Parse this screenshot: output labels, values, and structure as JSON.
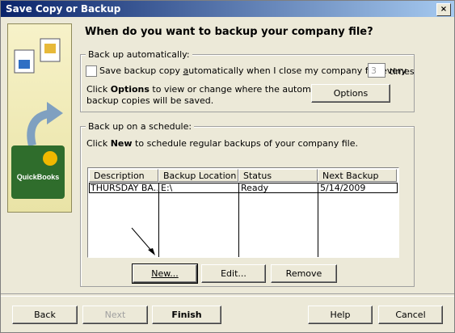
{
  "window": {
    "title": "Save Copy or Backup",
    "close_label": "×"
  },
  "heading": "When do you want to backup your company file?",
  "auto_backup": {
    "legend": "Back up automatically:",
    "checkbox_label_pre": "Save backup copy ",
    "checkbox_label_u": "a",
    "checkbox_label_post": "utomatically when I close my company file every",
    "times_value": "3",
    "times_label": "times",
    "info_pre": "Click ",
    "info_bold": "Options",
    "info_post_line1": " to view or change where the automatic",
    "info_line2": "backup copies will be saved.",
    "options_button": "Options"
  },
  "schedule": {
    "legend": "Back up on a schedule:",
    "info_pre": "Click ",
    "info_bold": "New",
    "info_post": " to schedule regular backups of your company file.",
    "columns": [
      "Description",
      "Backup Location",
      "Status",
      "Next Backup"
    ],
    "rows": [
      {
        "description": "THURSDAY BA...",
        "location": "E:\\",
        "status": "Ready",
        "next": "5/14/2009"
      }
    ],
    "new_button": "New...",
    "edit_button": "Edit...",
    "remove_button": "Remove"
  },
  "footer": {
    "back": "Back",
    "next": "Next",
    "finish": "Finish",
    "help": "Help",
    "cancel": "Cancel"
  },
  "side_logo_text": "QuickBooks"
}
